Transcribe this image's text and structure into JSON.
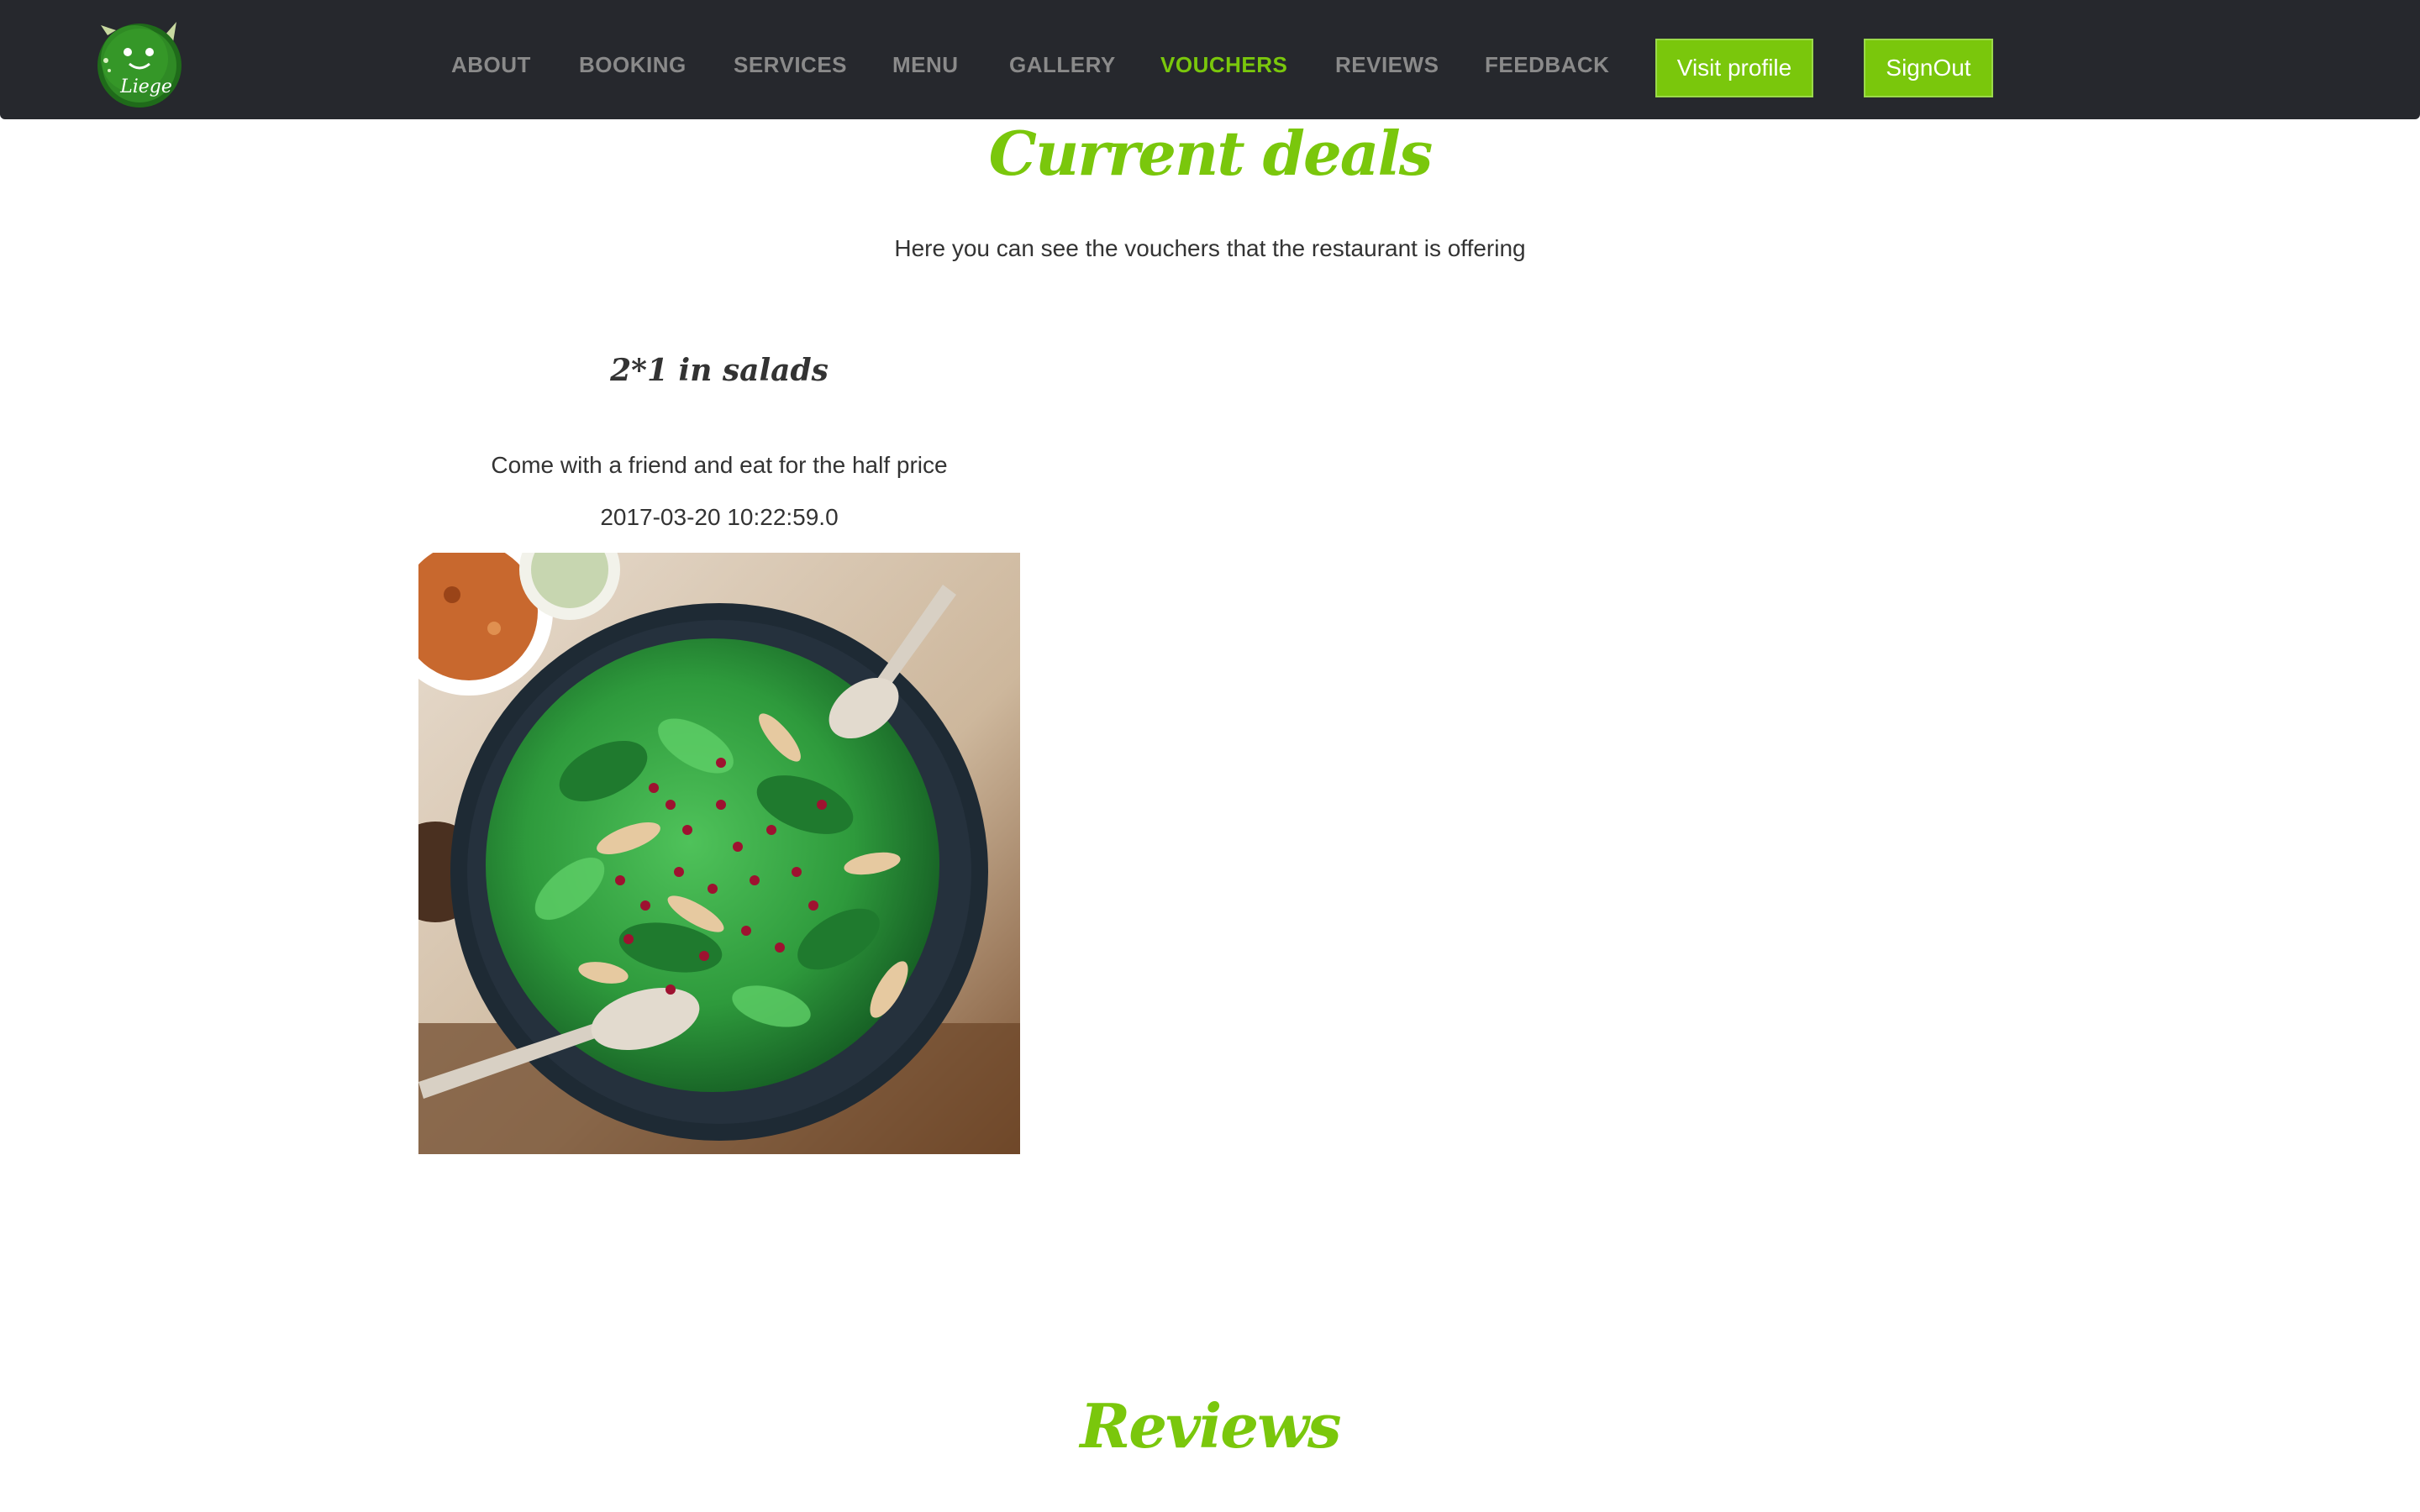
{
  "nav": {
    "logo": "restaurant-logo",
    "items": [
      {
        "label": "ABOUT"
      },
      {
        "label": "BOOKING"
      },
      {
        "label": "SERVICES"
      },
      {
        "label": "MENU"
      },
      {
        "label": "GALLERY"
      },
      {
        "label": "VOUCHERS",
        "active": true
      },
      {
        "label": "REVIEWS"
      },
      {
        "label": "FEEDBACK"
      }
    ],
    "visit_profile": "Visit profile",
    "sign_out": "SignOut"
  },
  "deals_section": {
    "title": "Current deals",
    "subtitle": "Here you can see the vouchers that the restaurant is offering"
  },
  "vouchers": [
    {
      "title": "2*1 in salads",
      "description": "Come with a friend and eat for the half price",
      "date": "2017-03-20 10:22:59.0",
      "image": "salad-bowl-image"
    }
  ],
  "reviews_section": {
    "title": "Reviews"
  },
  "colors": {
    "accent": "#7ac70c",
    "navbar": "#26282d",
    "nav_text": "#8a8a8a"
  }
}
